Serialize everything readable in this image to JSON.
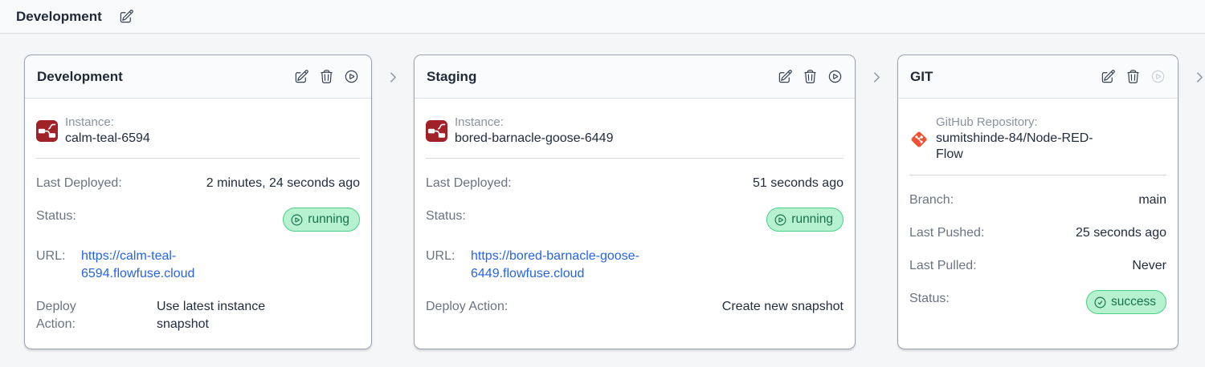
{
  "topbar": {
    "title": "Development",
    "edit_icon": "pencil-square-icon"
  },
  "colors": {
    "badge_green_bg": "#b6f2cf",
    "badge_green_border": "#49cf86",
    "badge_green_text": "#17704f",
    "link_blue": "#2563eb",
    "node_red_brand": "#a02128",
    "git_orange": "#f15233",
    "card_border": "#9ca3af"
  },
  "icons": {
    "edit": "pencil-square-icon",
    "delete": "trash-icon",
    "run": "play-circle-icon",
    "next": "chevron-right-icon",
    "running_badge": "play-circle-icon",
    "success_badge": "check-circle-icon",
    "instance": "node-red-icon",
    "repository": "git-icon"
  },
  "stages": [
    {
      "title": "Development",
      "source": {
        "label": "Instance:",
        "name": "calm-teal-6594"
      },
      "rows": {
        "deployed": {
          "label": "Last Deployed:",
          "value": "2 minutes, 24 seconds ago"
        },
        "status": {
          "label": "Status:",
          "badge": "running"
        },
        "url": {
          "label": "URL:",
          "text": "https://calm-teal-6594.flowfuse.cloud"
        },
        "deploy_action": {
          "label": "Deploy Action:",
          "value": "Use latest instance snapshot"
        }
      }
    },
    {
      "title": "Staging",
      "source": {
        "label": "Instance:",
        "name": "bored-barnacle-goose-6449"
      },
      "rows": {
        "deployed": {
          "label": "Last Deployed:",
          "value": "51 seconds ago"
        },
        "status": {
          "label": "Status:",
          "badge": "running"
        },
        "url": {
          "label": "URL:",
          "text": "https://bored-barnacle-goose-6449.flowfuse.cloud"
        },
        "deploy_action": {
          "label": "Deploy Action:",
          "value": "Create new snapshot"
        }
      }
    },
    {
      "title": "GIT",
      "source": {
        "label": "GitHub Repository:",
        "name": "sumitshinde-84/Node-RED-Flow"
      },
      "rows": {
        "branch": {
          "label": "Branch:",
          "value": "main"
        },
        "pushed": {
          "label": "Last Pushed:",
          "value": "25 seconds ago"
        },
        "pulled": {
          "label": "Last Pulled:",
          "value": "Never"
        },
        "status": {
          "label": "Status:",
          "badge": "success"
        }
      }
    }
  ]
}
